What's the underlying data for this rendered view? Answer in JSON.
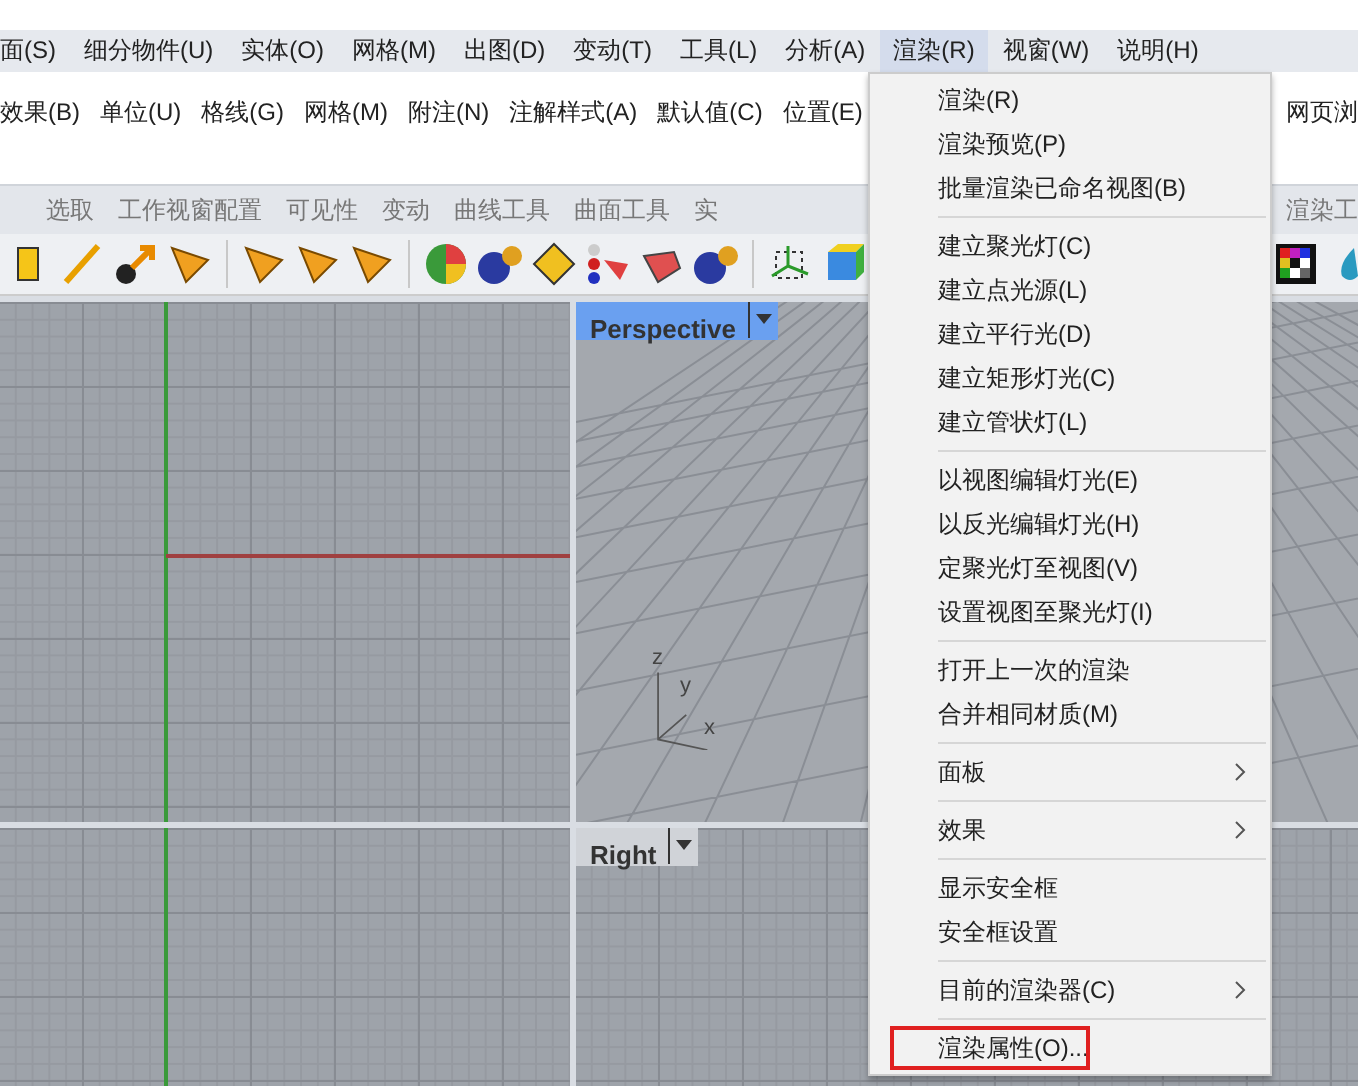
{
  "menubar": [
    {
      "label": "面(S)",
      "selected": false
    },
    {
      "label": "细分物件(U)",
      "selected": false
    },
    {
      "label": "实体(O)",
      "selected": false
    },
    {
      "label": "网格(M)",
      "selected": false
    },
    {
      "label": "出图(D)",
      "selected": false
    },
    {
      "label": "变动(T)",
      "selected": false
    },
    {
      "label": "工具(L)",
      "selected": false
    },
    {
      "label": "分析(A)",
      "selected": false
    },
    {
      "label": "渲染(R)",
      "selected": true
    },
    {
      "label": "视窗(W)",
      "selected": false
    },
    {
      "label": "说明(H)",
      "selected": false
    }
  ],
  "submenu_bar": {
    "items": [
      "效果(B)",
      "单位(U)",
      "格线(G)",
      "网格(M)",
      "附注(N)",
      "注解样式(A)",
      "默认值(C)",
      "位置(E)"
    ],
    "right_item": "网页浏"
  },
  "toolbar_tabs": {
    "items": [
      {
        "label": "选取",
        "selected": false
      },
      {
        "label": "工作视窗配置",
        "selected": false
      },
      {
        "label": "可见性",
        "selected": false
      },
      {
        "label": "变动",
        "selected": false
      },
      {
        "label": "曲线工具",
        "selected": false
      },
      {
        "label": "曲面工具",
        "selected": false
      },
      {
        "label": "实",
        "selected": false
      }
    ],
    "right_item": "渲染工"
  },
  "viewports": [
    {
      "label": "Perspective",
      "selected": true,
      "axes": [
        "z",
        "y",
        "x"
      ]
    },
    {
      "label": "Right",
      "selected": false
    }
  ],
  "render_menu": {
    "groups": [
      [
        {
          "label": "渲染(R)",
          "kind": "item",
          "outlined": false
        },
        {
          "label": "渲染预览(P)",
          "kind": "item",
          "outlined": false
        },
        {
          "label": "批量渲染已命名视图(B)",
          "kind": "item",
          "outlined": false
        }
      ],
      [
        {
          "label": "建立聚光灯(C)",
          "kind": "item",
          "outlined": false
        },
        {
          "label": "建立点光源(L)",
          "kind": "item",
          "outlined": false
        },
        {
          "label": "建立平行光(D)",
          "kind": "item",
          "outlined": false
        },
        {
          "label": "建立矩形灯光(C)",
          "kind": "item",
          "outlined": false
        },
        {
          "label": "建立管状灯(L)",
          "kind": "item",
          "outlined": false
        }
      ],
      [
        {
          "label": "以视图编辑灯光(E)",
          "kind": "item",
          "outlined": false
        },
        {
          "label": "以反光编辑灯光(H)",
          "kind": "item",
          "outlined": false
        },
        {
          "label": "定聚光灯至视图(V)",
          "kind": "item",
          "outlined": false
        },
        {
          "label": "设置视图至聚光灯(I)",
          "kind": "item",
          "outlined": false
        }
      ],
      [
        {
          "label": "打开上一次的渲染",
          "kind": "item",
          "outlined": false
        },
        {
          "label": "合并相同材质(M)",
          "kind": "item",
          "outlined": false
        }
      ],
      [
        {
          "label": "面板",
          "kind": "submenu",
          "outlined": false
        }
      ],
      [
        {
          "label": "效果",
          "kind": "submenu",
          "outlined": false
        }
      ],
      [
        {
          "label": "显示安全框",
          "kind": "item",
          "outlined": false
        },
        {
          "label": "安全框设置",
          "kind": "item",
          "outlined": false
        }
      ],
      [
        {
          "label": "目前的渲染器(C)",
          "kind": "submenu",
          "outlined": false
        }
      ],
      [
        {
          "label": "渲染属性(O)...",
          "kind": "item",
          "outlined": true
        }
      ]
    ]
  }
}
